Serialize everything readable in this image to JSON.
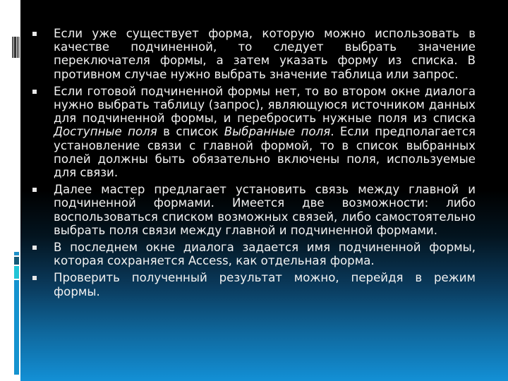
{
  "slide": {
    "bullets": [
      {
        "parts": [
          {
            "text": "Если уже существует форма, которую можно использовать в качестве подчиненной, то следует выбрать значение переключателя формы, а затем указать форму из списка. В противном случае нужно выбрать значение таблица или запрос."
          }
        ]
      },
      {
        "parts": [
          {
            "text": "Если готовой подчиненной формы нет, то во втором окне диалога нужно выбрать таблицу (запрос), являющуюся источником данных для подчиненной формы, и перебросить нужные поля из списка "
          },
          {
            "text": "Доступные поля",
            "italic": true
          },
          {
            "text": " в список "
          },
          {
            "text": "Выбранные поля",
            "italic": true
          },
          {
            "text": ". Если предполагается установление связи с главной формой, то в список выбранных полей должны быть обязательно включены поля, используемые для связи."
          }
        ]
      },
      {
        "parts": [
          {
            "text": "Далее мастер предлагает установить связь между главной и подчиненной формами. Имеется две возможности: либо воспользоваться списком возможных связей, либо самостоятельно выбрать поля связи между главной и подчиненной формами."
          }
        ]
      },
      {
        "parts": [
          {
            "text": "В последнем окне диалога задается имя подчиненной формы, которая сохраняется Access, как отдельная форма."
          }
        ]
      },
      {
        "parts": [
          {
            "text": "Проверить полученный результат можно, перейдя в режим формы."
          }
        ]
      }
    ]
  },
  "colors": {
    "text": "#f2f2f2",
    "background_top": "#000000",
    "background_bottom": "#1390d6",
    "bullet": "#e8e8e8"
  }
}
